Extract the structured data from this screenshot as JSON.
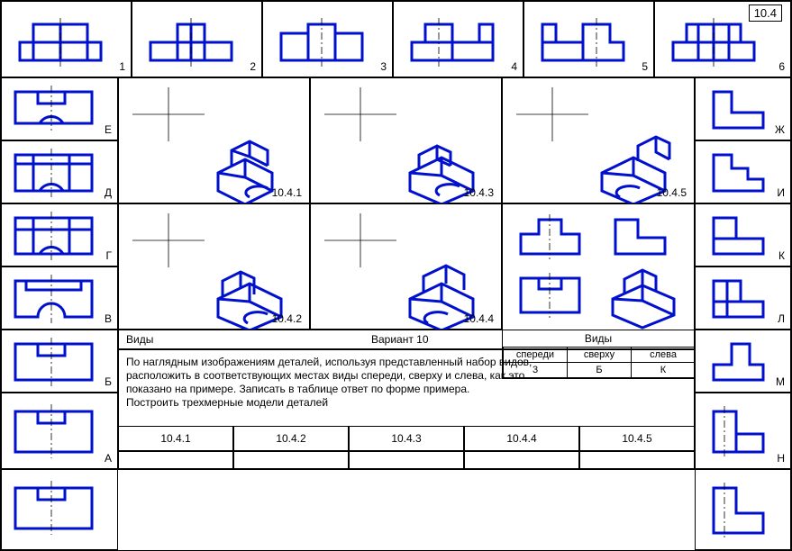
{
  "corner": "10.4",
  "top": {
    "labels": [
      "1",
      "2",
      "3",
      "4",
      "5",
      "6"
    ]
  },
  "left": {
    "labels": [
      "Е",
      "Д",
      "Г",
      "В",
      "Б",
      "А"
    ]
  },
  "right": {
    "labels": [
      "Ж",
      "И",
      "К",
      "Л",
      "М",
      "Н"
    ]
  },
  "iso": {
    "labels": [
      "10.4.1",
      "10.4.2",
      "10.4.3",
      "10.4.4",
      "10.4.5"
    ]
  },
  "example": {
    "title": "Виды",
    "headers": [
      "спереди",
      "сверху",
      "слева"
    ],
    "values": [
      "3",
      "Б",
      "К"
    ]
  },
  "title_row": {
    "views": "Виды",
    "variant": "Вариант  10"
  },
  "instructions": "По наглядным изображениям деталей, используя представленный набор видов,\nрасположить в соответствующих местах виды спереди, сверху и слева, как это\nпоказано на примере. Записать в таблице ответ по форме  примера.\nПостроить трехмерные модели деталей",
  "bottom": {
    "labels": [
      "10.4.1",
      "10.4.2",
      "10.4.3",
      "10.4.4",
      "10.4.5"
    ]
  },
  "chart_data": {
    "type": "table",
    "description": "Engineering drawing multi-view matching exercise 10.4",
    "top_views_numbered": [
      1,
      2,
      3,
      4,
      5,
      6
    ],
    "left_views_lettered": [
      "Е",
      "Д",
      "Г",
      "В",
      "Б",
      "А"
    ],
    "right_views_lettered": [
      "Ж",
      "И",
      "К",
      "Л",
      "М",
      "Н"
    ],
    "isometric_parts": [
      "10.4.1",
      "10.4.2",
      "10.4.3",
      "10.4.4",
      "10.4.5"
    ],
    "example_answer": {
      "part": "example",
      "спереди": 3,
      "сверху": "Б",
      "слева": "К"
    },
    "answers_required_for": [
      "10.4.1",
      "10.4.2",
      "10.4.3",
      "10.4.4",
      "10.4.5"
    ]
  }
}
